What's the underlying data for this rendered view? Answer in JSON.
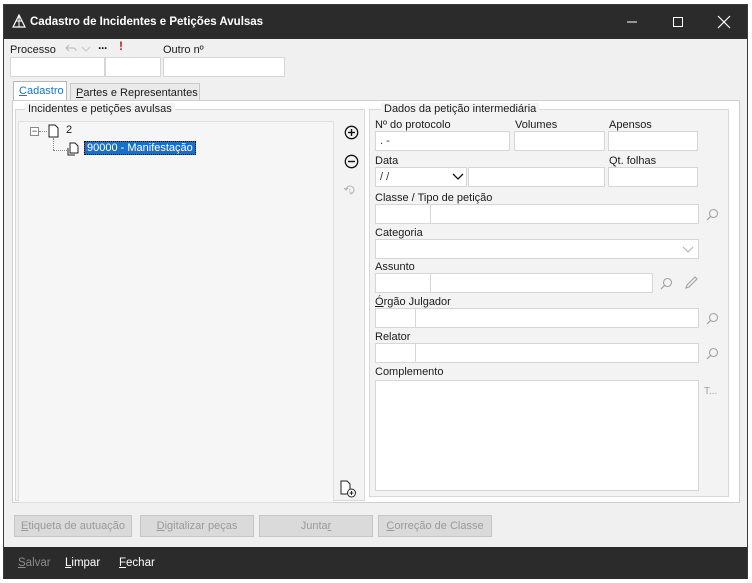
{
  "window": {
    "title": "Cadastro de Incidentes e Petições Avulsas",
    "controls": {
      "minimize": "—",
      "maximize": "☐",
      "close": "✕"
    }
  },
  "header": {
    "processo_label": "Processo",
    "processo_value": "",
    "processo_number": "",
    "outro_label": "Outro nº",
    "outro_value": "",
    "more_icon_text": "···",
    "alert_icon_text": "!"
  },
  "tabs": [
    {
      "label_first": "C",
      "label_rest": "adastro",
      "active": true
    },
    {
      "label_first": "P",
      "label_rest": "artes e Representantes",
      "active": false
    }
  ],
  "incidentes": {
    "title": "Incidentes e petições avulsas",
    "root_label": "2",
    "child_label": "90000 - Manifestação"
  },
  "dados": {
    "title": "Dados da petição intermediária",
    "protocolo_label": "Nº do protocolo",
    "protocolo_value": " .        -",
    "volumes_label": "Volumes",
    "apensos_label": "Apensos",
    "data_label": "Data",
    "data_value": " / /",
    "qt_folhas_label": "Qt. folhas",
    "classe_label": "Classe / Tipo de petição",
    "categoria_label": "Categoria",
    "assunto_label": "Assunto",
    "orgao_label_first": "Ó",
    "orgao_label_rest": "rgão Julgador",
    "relator_label": "Relator",
    "complemento_label": "Complemento",
    "complemento_action": "T..."
  },
  "buttons": [
    {
      "first": "E",
      "rest": "tiqueta de autuação"
    },
    {
      "first": "D",
      "rest": "igitalizar peças"
    },
    {
      "pre": "Junta",
      "first": "r",
      "rest": ""
    },
    {
      "first": "C",
      "rest": "orreção de Classe"
    }
  ],
  "footer": {
    "salvar_first": "S",
    "salvar_rest": "alvar",
    "limpar_first": "L",
    "limpar_rest": "impar",
    "fechar_first": "F",
    "fechar_rest": "echar"
  },
  "colors": {
    "titlebar": "#2b2b2b",
    "accent": "#1a6fc7",
    "alert": "#d01818"
  }
}
